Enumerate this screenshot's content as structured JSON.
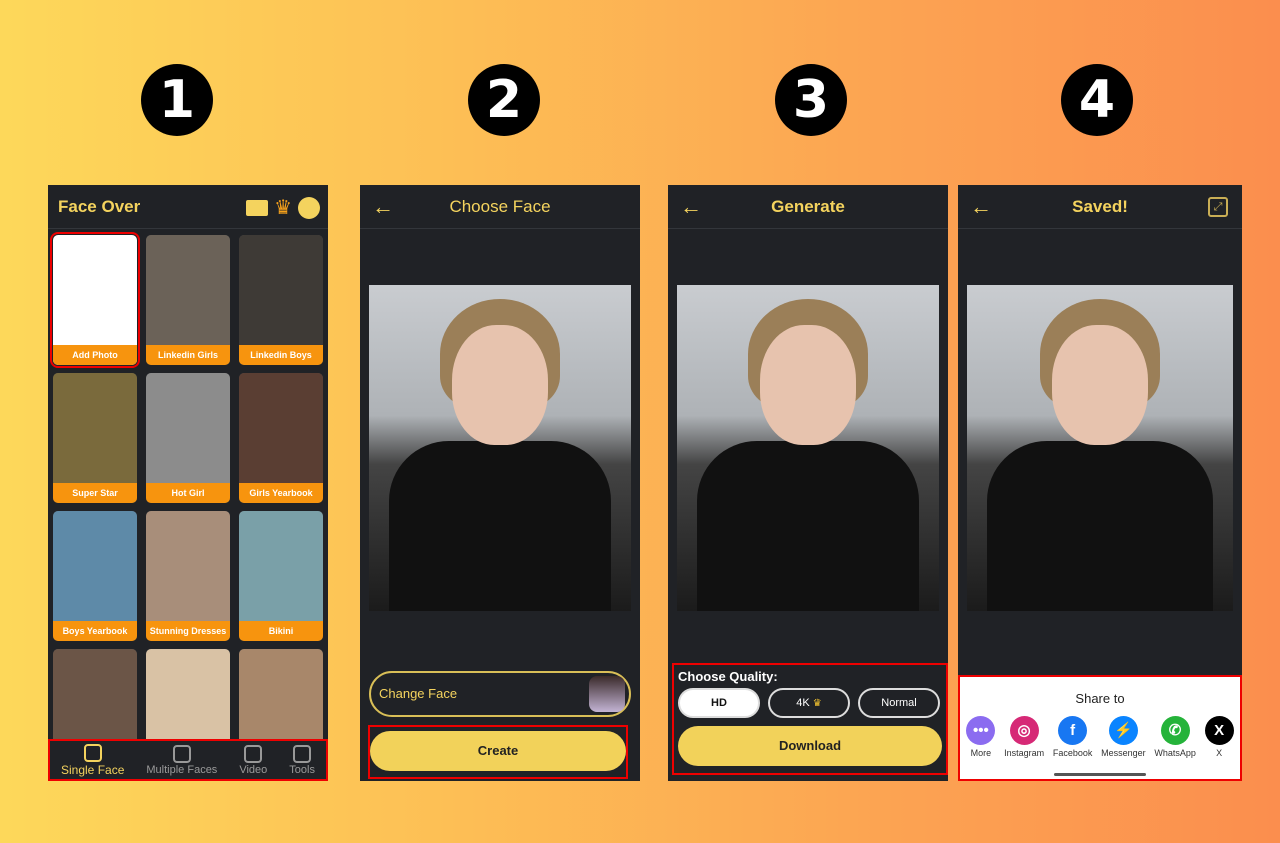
{
  "steps": [
    "1",
    "2",
    "3",
    "4"
  ],
  "screen1": {
    "app_title": "Face Over",
    "header_icons": [
      "folder-icon",
      "crown-icon",
      "account-icon"
    ],
    "cards": [
      {
        "label": "Add Photo",
        "color": "#ffffff"
      },
      {
        "label": "Linkedin Girls",
        "color": "#6b6258"
      },
      {
        "label": "Linkedin Boys",
        "color": "#3e3a36"
      },
      {
        "label": "Super Star",
        "color": "#7a6a3c"
      },
      {
        "label": "Hot Girl",
        "color": "#8c8c8c"
      },
      {
        "label": "Girls Yearbook",
        "color": "#5a3e33"
      },
      {
        "label": "Boys Yearbook",
        "color": "#5e8aa8"
      },
      {
        "label": "Stunning Dresses",
        "color": "#a88e7a"
      },
      {
        "label": "Bikini",
        "color": "#7aa0a8"
      },
      {
        "label": "",
        "color": "#6b5547"
      },
      {
        "label": "",
        "color": "#d9c2a5"
      },
      {
        "label": "",
        "color": "#a8876a"
      }
    ],
    "nav": [
      {
        "label": "Single Face",
        "active": true
      },
      {
        "label": "Multiple Faces",
        "active": false
      },
      {
        "label": "Video",
        "active": false
      },
      {
        "label": "Tools",
        "active": false
      }
    ]
  },
  "screen2": {
    "title": "Choose Face",
    "change_face_label": "Change Face",
    "create_label": "Create"
  },
  "screen3": {
    "title": "Generate",
    "quality_label": "Choose Quality:",
    "options": [
      "HD",
      "4K",
      "Normal"
    ],
    "selected": "HD",
    "download_label": "Download"
  },
  "screen4": {
    "title": "Saved!",
    "share_title": "Share to",
    "share_targets": [
      {
        "label": "More",
        "glyph": "•••",
        "color": "#8b6cf0"
      },
      {
        "label": "Instagram",
        "glyph": "◎",
        "color": "#d62976"
      },
      {
        "label": "Facebook",
        "glyph": "f",
        "color": "#1877f2"
      },
      {
        "label": "Messenger",
        "glyph": "⚡",
        "color": "#0a84ff"
      },
      {
        "label": "WhatsApp",
        "glyph": "✆",
        "color": "#25b33a"
      },
      {
        "label": "X",
        "glyph": "X",
        "color": "#000000"
      }
    ]
  }
}
